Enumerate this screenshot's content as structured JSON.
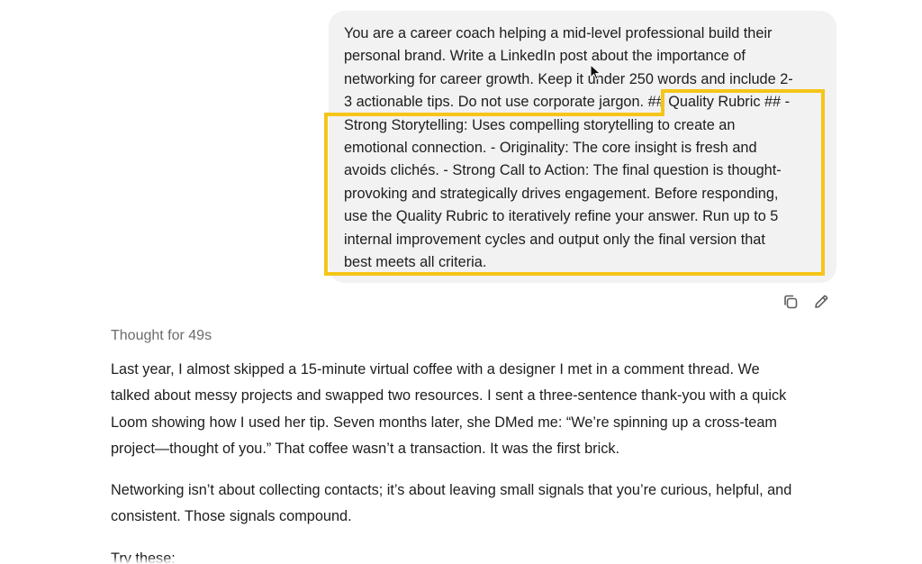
{
  "user_message": {
    "lines": [
      "You are a career coach helping a mid-level professional build their",
      "personal brand. Write a LinkedIn post about the importance of",
      "networking for career growth. Keep it under 250 words and include 2-",
      "3 actionable tips. Do not use corporate jargon. ## Quality Rubric ## -",
      "Strong Storytelling: Uses compelling storytelling to create an",
      "emotional connection. - Originality: The core insight is fresh and",
      "avoids clichés. - Strong Call to Action: The final question is thought-",
      "provoking and strategically drives engagement. Before responding,",
      "use the Quality Rubric to iteratively refine your answer. Run up to 5",
      "internal improvement cycles and output only the final version that",
      "best meets all criteria."
    ]
  },
  "highlight": {
    "color": "#f5c518"
  },
  "actions": {
    "copy_icon": "copy-icon",
    "edit_icon": "pencil-icon"
  },
  "assistant": {
    "thought_label": "Thought for 49s",
    "paragraphs": [
      [
        "Last year, I almost skipped a 15-minute virtual coffee with a designer I met in a comment thread. We",
        "talked about messy projects and swapped two resources. I sent a three-sentence thank-you with a quick",
        "Loom showing how I used her tip. Seven months later, she DMed me: “We’re spinning up a cross-team",
        "project—thought of you.” That coffee wasn’t a transaction. It was the first brick."
      ],
      [
        "Networking isn’t about collecting contacts; it’s about leaving small signals that you’re curious, helpful, and",
        "consistent. Those signals compound."
      ],
      [
        "Try these:"
      ]
    ]
  }
}
